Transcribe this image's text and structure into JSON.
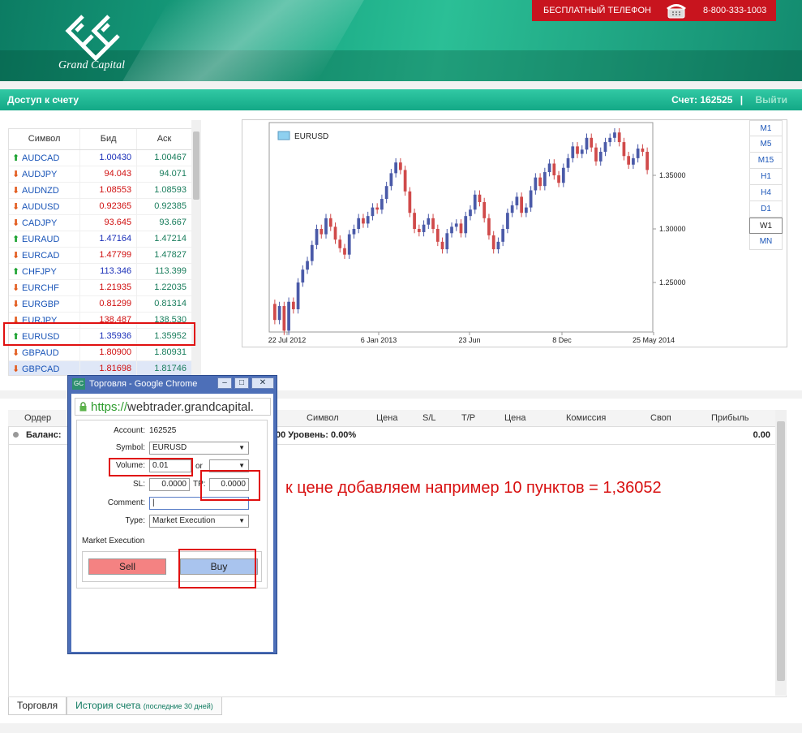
{
  "header": {
    "brand": "Grand Capital",
    "phone_label": "БЕСПЛАТНЫЙ ТЕЛЕФОН",
    "phone_number": "8-800-333-1003"
  },
  "bar": {
    "title": "Доступ к счету",
    "account_label": "Счет: 162525",
    "separator": "|",
    "exit_label": "Выйти"
  },
  "quotes": {
    "columns": [
      "Символ",
      "Бид",
      "Аск"
    ],
    "rows": [
      {
        "symbol": "AUDCAD",
        "dir": "up",
        "bid": "1.00430",
        "ask": "1.00467"
      },
      {
        "symbol": "AUDJPY",
        "dir": "down",
        "bid": "94.043",
        "ask": "94.071"
      },
      {
        "symbol": "AUDNZD",
        "dir": "down",
        "bid": "1.08553",
        "ask": "1.08593"
      },
      {
        "symbol": "AUDUSD",
        "dir": "down",
        "bid": "0.92365",
        "ask": "0.92385"
      },
      {
        "symbol": "CADJPY",
        "dir": "down",
        "bid": "93.645",
        "ask": "93.667"
      },
      {
        "symbol": "EURAUD",
        "dir": "up",
        "bid": "1.47164",
        "ask": "1.47214"
      },
      {
        "symbol": "EURCAD",
        "dir": "down",
        "bid": "1.47799",
        "ask": "1.47827"
      },
      {
        "symbol": "CHFJPY",
        "dir": "up",
        "bid": "113.346",
        "ask": "113.399"
      },
      {
        "symbol": "EURCHF",
        "dir": "down",
        "bid": "1.21935",
        "ask": "1.22035"
      },
      {
        "symbol": "EURGBP",
        "dir": "down",
        "bid": "0.81299",
        "ask": "0.81314"
      },
      {
        "symbol": "EURJPY",
        "dir": "down",
        "bid": "138.487",
        "ask": "138.530"
      },
      {
        "symbol": "EURUSD",
        "dir": "up",
        "bid": "1.35936",
        "ask": "1.35952"
      },
      {
        "symbol": "GBPAUD",
        "dir": "down",
        "bid": "1.80900",
        "ask": "1.80931"
      },
      {
        "symbol": "GBPCAD",
        "dir": "down",
        "bid": "1.81698",
        "ask": "1.81746"
      }
    ]
  },
  "chart": {
    "legend": "EURUSD",
    "y_ticks": [
      "1.35000",
      "1.30000",
      "1.25000"
    ],
    "x_ticks": [
      "22 Jul 2012",
      "6 Jan 2013",
      "23 Jun",
      "8 Dec",
      "25 May 2014"
    ],
    "timeframes": [
      "M1",
      "M5",
      "M15",
      "H1",
      "H4",
      "D1",
      "W1",
      "MN"
    ],
    "active_timeframe": "W1",
    "colors": {
      "up": "#4a5aa8",
      "down": "#d04a4a"
    }
  },
  "orders": {
    "columns": [
      "Ордер",
      "Символ",
      "Цена",
      "S/L",
      "T/P",
      "Цена",
      "Комиссия",
      "Своп",
      "Прибыль"
    ],
    "balance_label": "Баланс:",
    "level_text": "00 Уровень: 0.00%",
    "profit_total": "0.00",
    "tabs": [
      {
        "label": "Торговля",
        "note": ""
      },
      {
        "label": "История счета",
        "note": "(последние 30 дней)"
      }
    ]
  },
  "annotation": "к цене добавляем например 10 пунктов = 1,36052",
  "popup": {
    "title": "Торговля - Google Chrome",
    "url_scheme": "https://",
    "url_host": "webtrader.grandcapital.",
    "account_label": "Account:",
    "account_value": "162525",
    "symbol_label": "Symbol:",
    "symbol_value": "EURUSD",
    "volume_label": "Volume:",
    "volume_value": "0.01",
    "or_label": "or",
    "sl_label": "SL:",
    "sl_value": "0.0000",
    "tp_label": "TP:",
    "tp_value": "0.0000",
    "comment_label": "Comment:",
    "type_label": "Type:",
    "type_value": "Market Execution",
    "section_label": "Market Execution",
    "sell_label": "Sell",
    "buy_label": "Buy"
  }
}
